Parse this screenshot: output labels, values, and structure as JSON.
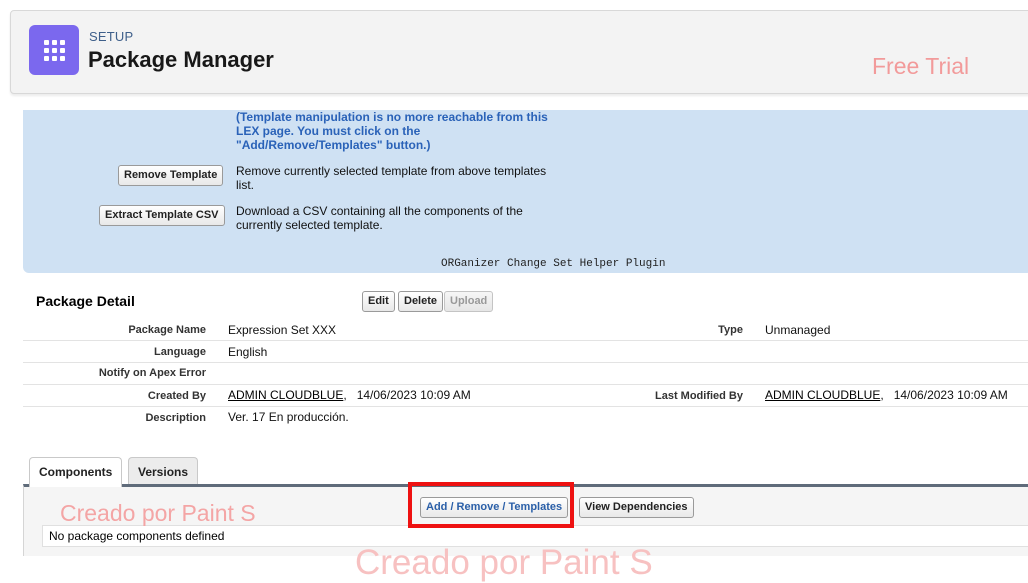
{
  "header": {
    "eyebrow": "SETUP",
    "title": "Package Manager",
    "app_icon": "app-launcher-grid-icon",
    "watermark": "Free Trial"
  },
  "helper_panel": {
    "note": "(Template manipulation is no more reachable from this LEX page. You must click on the \"Add/Remove/Templates\" button.)",
    "remove_template_label": "Remove Template",
    "remove_template_desc": "Remove currently selected template from above templates list.",
    "extract_csv_label": "Extract Template CSV",
    "extract_csv_desc": "Download a CSV containing all the components of the currently selected template.",
    "plugin_label": "ORGanizer Change Set Helper Plugin",
    "background_color": "#cfe1f3"
  },
  "package_detail": {
    "title": "Package Detail",
    "buttons": {
      "edit": "Edit",
      "delete": "Delete",
      "upload": "Upload"
    },
    "fields": {
      "package_name_label": "Package Name",
      "package_name": "Expression Set XXX",
      "type_label": "Type",
      "type": "Unmanaged",
      "language_label": "Language",
      "language": "English",
      "notify_label": "Notify on Apex Error",
      "notify": "",
      "created_by_label": "Created By",
      "created_by_user": "ADMIN CLOUDBLUE",
      "created_by_date": "14/06/2023 10:09 AM",
      "modified_by_label": "Last Modified By",
      "modified_by_user": "ADMIN CLOUDBLUE",
      "modified_by_date": "14/06/2023 10:09 AM",
      "description_label": "Description",
      "description": "Ver. 17 En producción."
    }
  },
  "tabs": {
    "components": "Components",
    "versions": "Versions"
  },
  "components": {
    "add_remove_label": "Add / Remove / Templates",
    "view_deps_label": "View Dependencies",
    "empty_message": "No package components defined",
    "highlight_color": "#ee1111"
  },
  "watermarks": {
    "creado_small": "Creado por Paint S",
    "creado_large": "Creado por Paint S"
  }
}
